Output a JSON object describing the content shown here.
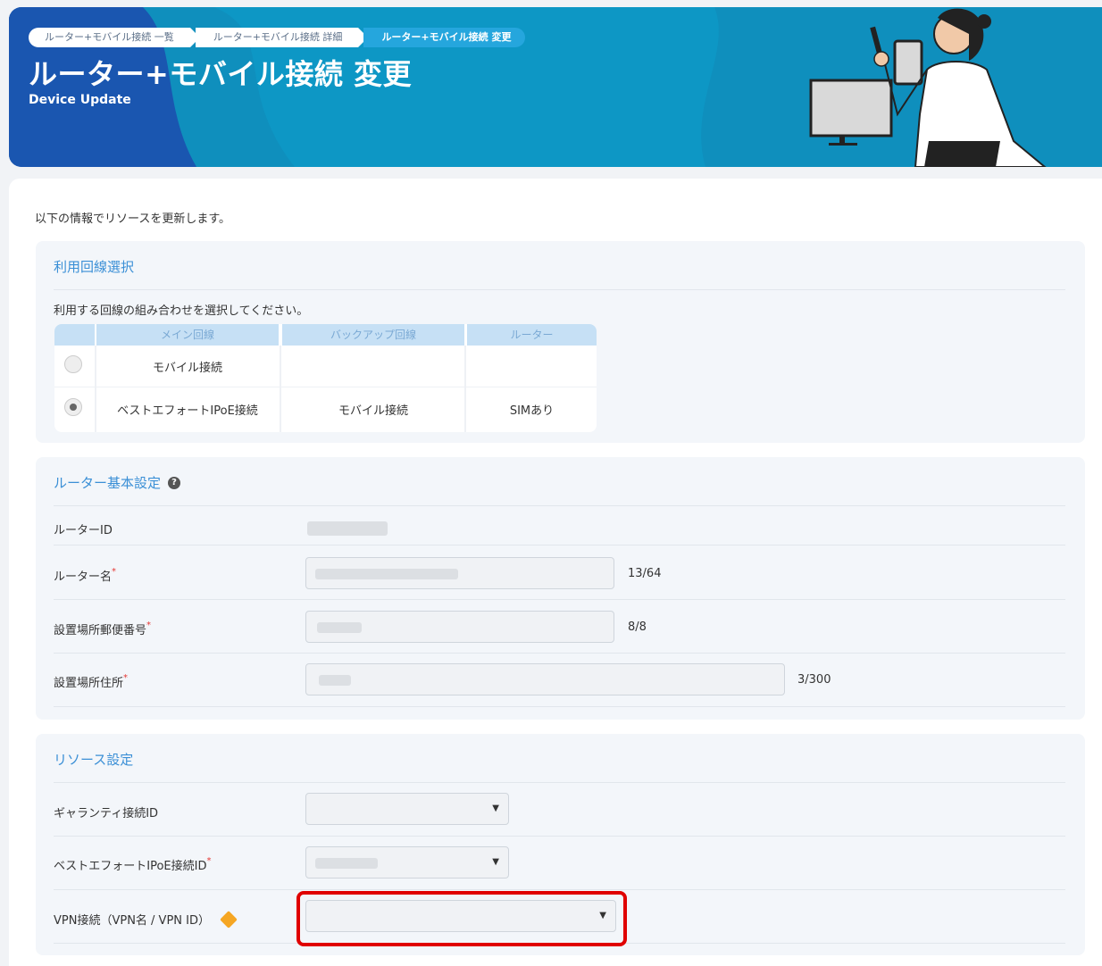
{
  "header": {
    "breadcrumbs": [
      "ルーター+モバイル接続 一覧",
      "ルーター+モバイル接続 詳細",
      "ルーター+モバイル接続 変更"
    ],
    "title": "ルーター+モバイル接続 変更",
    "subtitle": "Device Update"
  },
  "intro": "以下の情報でリソースを更新します。",
  "line_select": {
    "title": "利用回線選択",
    "instruction": "利用する回線の組み合わせを選択してください。",
    "columns": [
      "メイン回線",
      "バックアップ回線",
      "ルーター"
    ],
    "rows": [
      {
        "main": "モバイル接続",
        "backup": "",
        "router": "",
        "selected": false
      },
      {
        "main": "ベストエフォートIPoE接続",
        "backup": "モバイル接続",
        "router": "SIMあり",
        "selected": true
      }
    ]
  },
  "router_settings": {
    "title": "ルーター基本設定",
    "router_id_label": "ルーターID",
    "router_name_label": "ルーター名",
    "router_name_count": "13/64",
    "postal_label": "設置場所郵便番号",
    "postal_count": "8/8",
    "address_label": "設置場所住所",
    "address_count": "3/300",
    "required_mark": "*"
  },
  "resource_settings": {
    "title": "リソース設定",
    "guaranty_label": "ギャランティ接続ID",
    "besteffort_label": "ベストエフォートIPoE接続ID",
    "vpn_label": "VPN接続（VPN名 / VPN ID）",
    "caret": "▼",
    "required_mark": "*"
  },
  "colors": {
    "accent_blue": "#3a8fd6",
    "banner_dark": "#1a56b0",
    "banner_teal": "#0f8fbd",
    "highlight_red": "#e00000",
    "warning": "#f5a623"
  }
}
